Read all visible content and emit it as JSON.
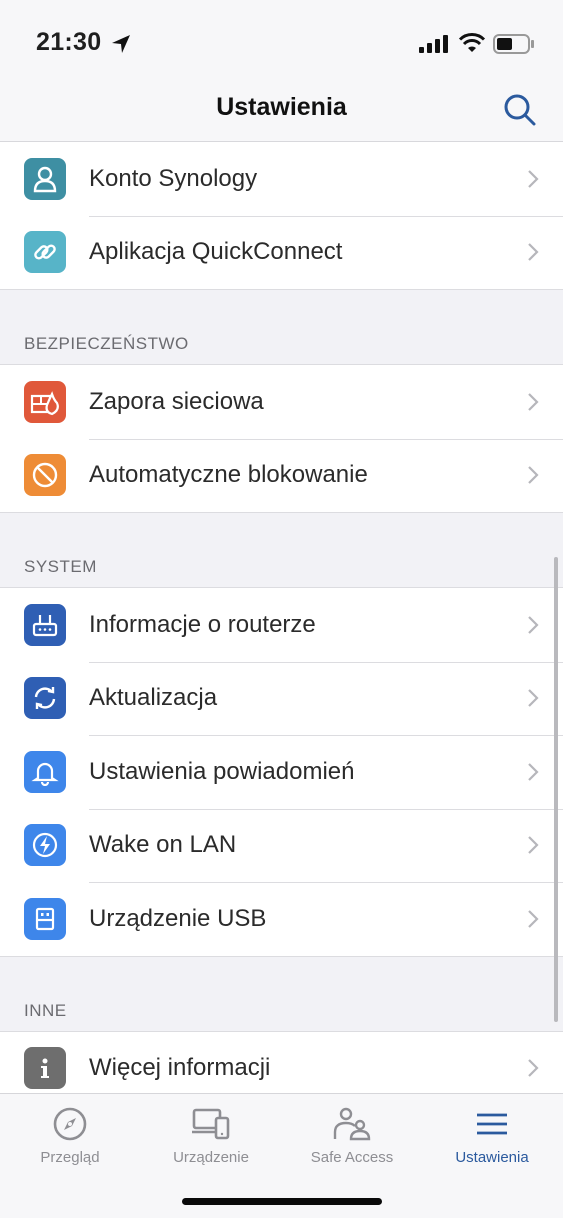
{
  "status": {
    "time": "21:30",
    "icons": [
      "location-arrow-icon",
      "signal-icon",
      "wifi-icon",
      "battery-icon"
    ]
  },
  "header": {
    "title": "Ustawienia",
    "search_icon": "search-icon"
  },
  "colors": {
    "accent": "#2b5a9e",
    "teal": "#3e8fa3",
    "teal_light": "#57b4c8",
    "red_orange": "#e0583a",
    "orange": "#ee8c36",
    "blue_dark": "#2f5fb4",
    "blue": "#3e86ea",
    "gray": "#6e6e6e"
  },
  "groups": [
    {
      "header": "",
      "items": [
        {
          "label": "Konto Synology",
          "icon": "user-icon"
        },
        {
          "label": "Aplikacja QuickConnect",
          "icon": "link-icon"
        }
      ]
    },
    {
      "header": "BEZPIECZEŃSTWO",
      "items": [
        {
          "label": "Zapora sieciowa",
          "icon": "firewall-icon"
        },
        {
          "label": "Automatyczne blokowanie",
          "icon": "block-icon"
        }
      ]
    },
    {
      "header": "SYSTEM",
      "items": [
        {
          "label": "Informacje o routerze",
          "icon": "router-icon"
        },
        {
          "label": "Aktualizacja",
          "icon": "refresh-icon"
        },
        {
          "label": "Ustawienia powiadomień",
          "icon": "bell-icon"
        },
        {
          "label": "Wake on LAN",
          "icon": "lightning-icon"
        },
        {
          "label": "Urządzenie USB",
          "icon": "usb-icon"
        }
      ]
    },
    {
      "header": "INNE",
      "items": [
        {
          "label": "Więcej informacji",
          "icon": "info-icon"
        }
      ]
    }
  ],
  "tabbar": {
    "tabs": [
      {
        "label": "Przegląd",
        "icon": "compass-icon",
        "active": false
      },
      {
        "label": "Urządzenie",
        "icon": "devices-icon",
        "active": false
      },
      {
        "label": "Safe Access",
        "icon": "family-icon",
        "active": false
      },
      {
        "label": "Ustawienia",
        "icon": "menu-icon",
        "active": true
      }
    ]
  }
}
